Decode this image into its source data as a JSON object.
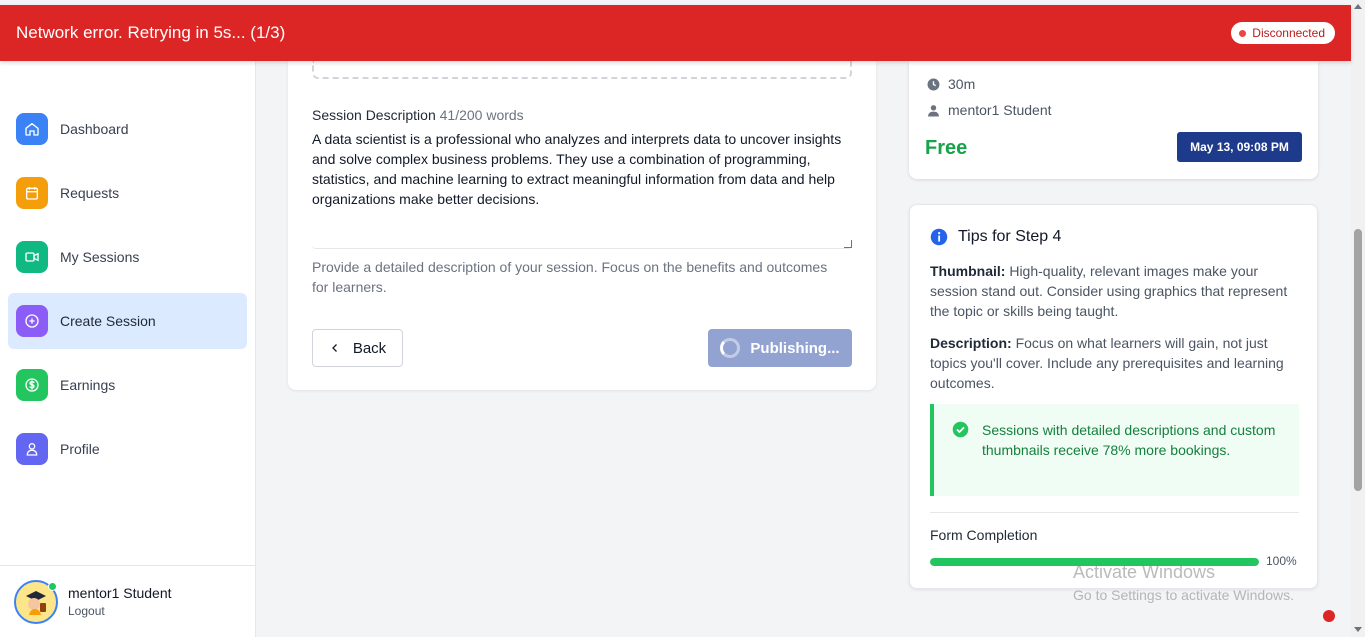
{
  "banner": {
    "message": "Network error. Retrying in 5s... (1/3)",
    "status": "Disconnected",
    "color": "#dc2626"
  },
  "sidebar": {
    "items": [
      {
        "label": "Dashboard",
        "icon": "home-icon",
        "color": "#3b82f6"
      },
      {
        "label": "Requests",
        "icon": "calendar-icon",
        "color": "#f59e0b"
      },
      {
        "label": "My Sessions",
        "icon": "video-icon",
        "color": "#10b981"
      },
      {
        "label": "Create Session",
        "icon": "plus-circle-icon",
        "color": "#8b5cf6",
        "active": true
      },
      {
        "label": "Earnings",
        "icon": "dollar-icon",
        "color": "#22c55e"
      },
      {
        "label": "Profile",
        "icon": "user-icon",
        "color": "#6366f1"
      }
    ],
    "user": {
      "name": "mentor1 Student",
      "logout": "Logout"
    }
  },
  "form": {
    "description_label": "Session Description",
    "description_count": "41/200 words",
    "description_value": "A data scientist is a professional who analyzes and interprets data to uncover insights and solve complex business problems. They use a combination of programming, statistics, and machine learning to extract meaningful information from data and help organizations make better decisions.",
    "help_text": "Provide a detailed description of your session. Focus on the benefits and outcomes for learners.",
    "back_label": "Back",
    "publish_label": "Publishing..."
  },
  "preview": {
    "duration": "30m",
    "mentor": "mentor1 Student",
    "price": "Free",
    "date": "May 13, 09:08 PM"
  },
  "tips": {
    "title": "Tips for Step 4",
    "thumbnail_label": "Thumbnail:",
    "thumbnail_text": "High-quality, relevant images make your session stand out. Consider using graphics that represent the topic or skills being taught.",
    "description_label": "Description:",
    "description_text": "Focus on what learners will gain, not just topics you'll cover. Include any prerequisites and learning outcomes.",
    "callout": "Sessions with detailed descriptions and custom thumbnails receive 78% more bookings.",
    "completion_label": "Form Completion",
    "completion_pct_label": "100%",
    "completion_value": 1.0
  },
  "watermark": {
    "line1": "Activate Windows",
    "line2": "Go to Settings to activate Windows."
  }
}
